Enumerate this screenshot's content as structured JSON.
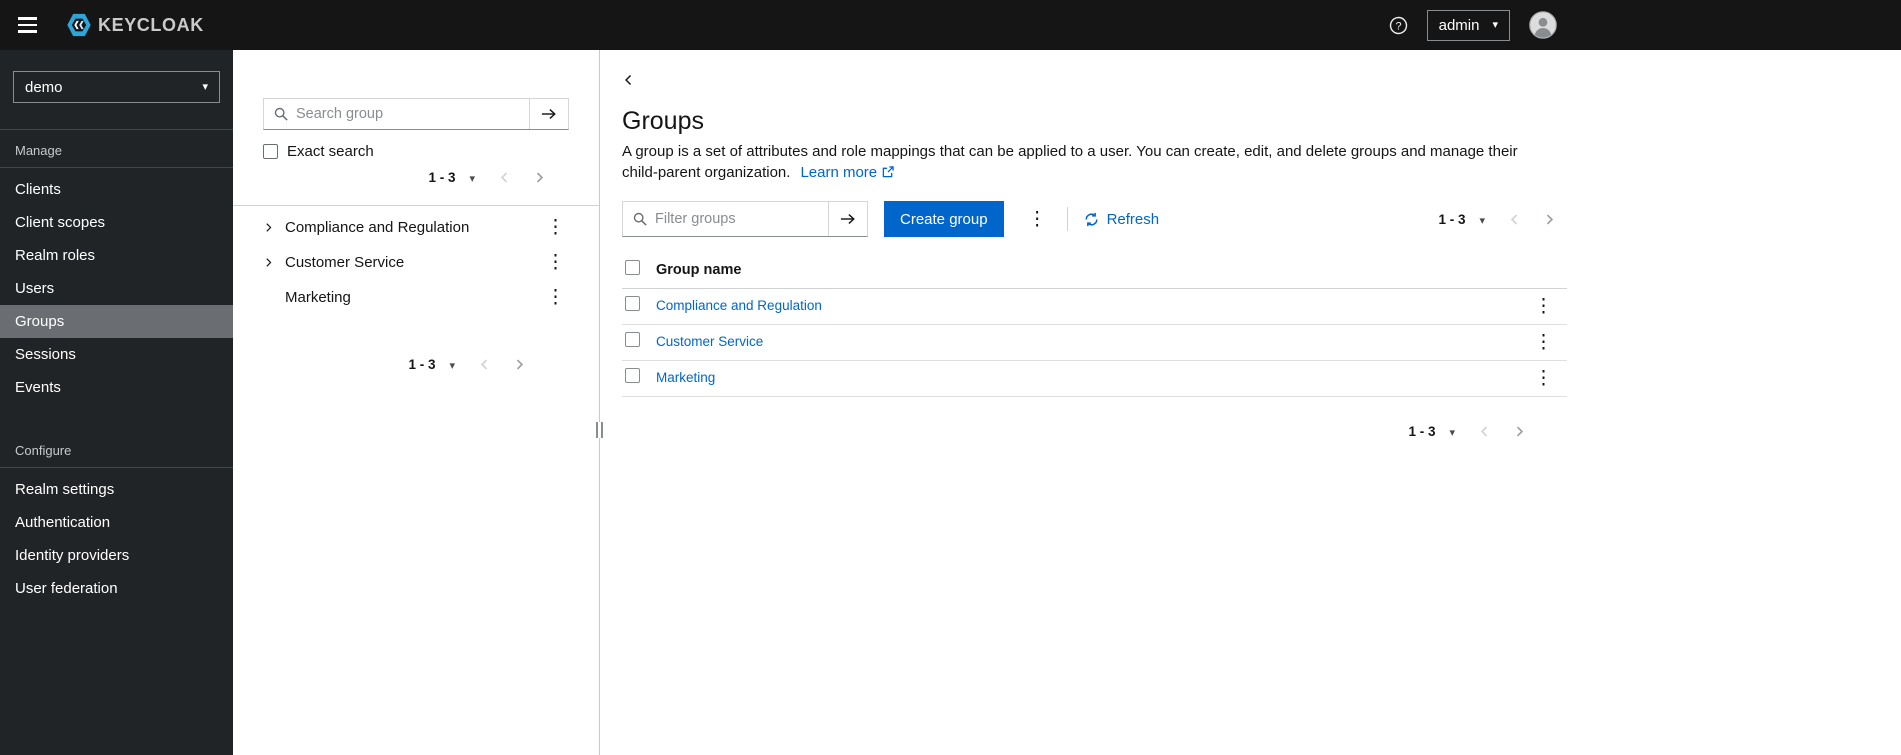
{
  "header": {
    "brand": "KEYCLOAK",
    "user_menu": "admin"
  },
  "sidebar": {
    "realm_selector": {
      "value": "demo"
    },
    "sections": [
      {
        "label": "Manage",
        "items": [
          {
            "label": "Clients",
            "selected": false
          },
          {
            "label": "Client scopes",
            "selected": false
          },
          {
            "label": "Realm roles",
            "selected": false
          },
          {
            "label": "Users",
            "selected": false
          },
          {
            "label": "Groups",
            "selected": true
          },
          {
            "label": "Sessions",
            "selected": false
          },
          {
            "label": "Events",
            "selected": false
          }
        ]
      },
      {
        "label": "Configure",
        "items": [
          {
            "label": "Realm settings",
            "selected": false
          },
          {
            "label": "Authentication",
            "selected": false
          },
          {
            "label": "Identity providers",
            "selected": false
          },
          {
            "label": "User federation",
            "selected": false
          }
        ]
      }
    ]
  },
  "tree_panel": {
    "search": {
      "placeholder": "Search group",
      "value": ""
    },
    "exact_search_label": "Exact search",
    "pagination_top": {
      "range": "1 - 3"
    },
    "groups": [
      {
        "label": "Compliance and Regulation",
        "expandable": true
      },
      {
        "label": "Customer Service",
        "expandable": true
      },
      {
        "label": "Marketing",
        "expandable": false
      }
    ],
    "pagination_bottom": {
      "range": "1 - 3"
    }
  },
  "main": {
    "title": "Groups",
    "description": "A group is a set of attributes and role mappings that can be applied to a user. You can create, edit, and delete groups and manage their child-parent organization.",
    "learn_more_label": "Learn more",
    "toolbar": {
      "filter": {
        "placeholder": "Filter groups",
        "value": ""
      },
      "create_button_label": "Create group",
      "refresh_label": "Refresh",
      "pagination": {
        "range": "1 - 3"
      }
    },
    "table": {
      "columns": [
        "Group name"
      ],
      "rows": [
        {
          "name": "Compliance and Regulation"
        },
        {
          "name": "Customer Service"
        },
        {
          "name": "Marketing"
        }
      ]
    },
    "pagination_bottom": {
      "range": "1 - 3"
    }
  },
  "icons": {
    "kebab": "⋮",
    "caret_down": "▾",
    "help_glyph": "?"
  },
  "colors": {
    "primary_blue": "#0066cc",
    "link_blue": "#0066cc",
    "header_bg": "#151515",
    "sidebar_bg": "#212427",
    "sidebar_selected_bg": "#6a6e73",
    "logo_cyan": "#2fa4d9"
  }
}
